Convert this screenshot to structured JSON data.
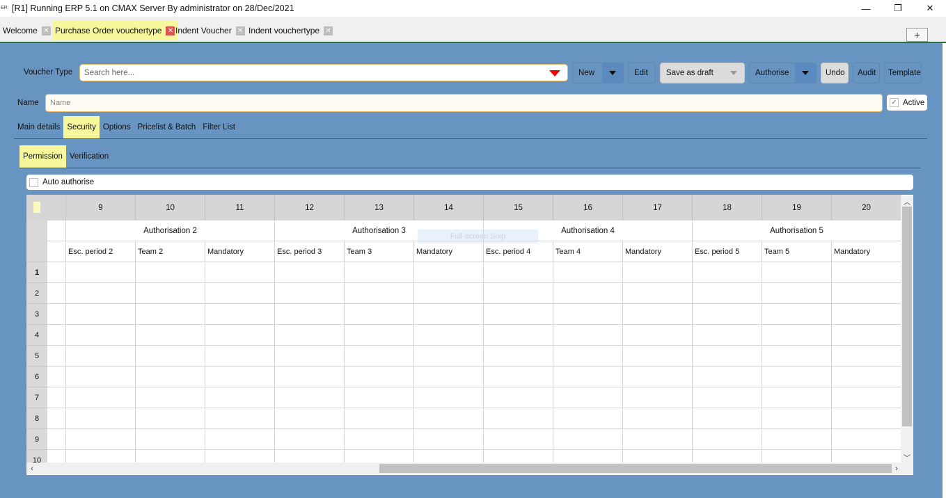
{
  "window": {
    "icon": "app-icon",
    "title": "[R1] Running ERP 5.1 on CMAX Server By administrator on 28/Dec/2021",
    "controls": {
      "minimize": "—",
      "restore": "❐",
      "close": "✕"
    }
  },
  "tabs": [
    {
      "label": "Welcome",
      "active": false
    },
    {
      "label": "Purchase Order vouchertype",
      "active": true
    },
    {
      "label": "Indent Voucher",
      "active": false
    },
    {
      "label": "Indent vouchertype",
      "active": false
    }
  ],
  "add_tab_label": "+",
  "toolbar": {
    "voucher_type_label": "Voucher Type",
    "search_placeholder": "Search here...",
    "new_label": "New",
    "edit_label": "Edit",
    "save_draft_label": "Save as draft",
    "authorise_label": "Authorise",
    "undo_label": "Undo",
    "audit_label": "Audit",
    "template_label": "Template"
  },
  "name_row": {
    "label": "Name",
    "placeholder": "Name",
    "active_label": "Active",
    "active_checked": true
  },
  "main_tabs": [
    {
      "label": "Main details",
      "active": false
    },
    {
      "label": "Security",
      "active": true
    },
    {
      "label": "Options",
      "active": false
    },
    {
      "label": "Pricelist & Batch",
      "active": false
    },
    {
      "label": "Filter List",
      "active": false
    }
  ],
  "sub_tabs": [
    {
      "label": "Permission",
      "active": true
    },
    {
      "label": "Verification",
      "active": false
    }
  ],
  "auto_authorise": {
    "label": "Auto authorise",
    "checked": false
  },
  "grid": {
    "column_numbers": [
      "9",
      "10",
      "11",
      "12",
      "13",
      "14",
      "15",
      "16",
      "17",
      "18",
      "19",
      "20"
    ],
    "groups": [
      {
        "label": "Authorisation 2",
        "span": 3
      },
      {
        "label": "Authorisation 3",
        "span": 3
      },
      {
        "label": "Authorisation 4",
        "span": 3
      },
      {
        "label": "Authorisation 5",
        "span": 3
      }
    ],
    "sub_headers": [
      "Esc. period 2",
      "Team 2",
      "Mandatory",
      "Esc. period 3",
      "Team 3",
      "Mandatory",
      "Esc. period 4",
      "Team 4",
      "Mandatory",
      "Esc. period 5",
      "Team 5",
      "Mandatory"
    ],
    "rows": [
      "1",
      "2",
      "3",
      "4",
      "5",
      "6",
      "7",
      "8",
      "9",
      "10"
    ]
  },
  "overlay_text": "Full-screen Snip",
  "colors": {
    "background": "#6794c1",
    "active_tab": "#f7f79e",
    "close_active": "#d9534f",
    "accent_line": "#2f6d3a",
    "dropdown_arrow": "#e00000"
  }
}
